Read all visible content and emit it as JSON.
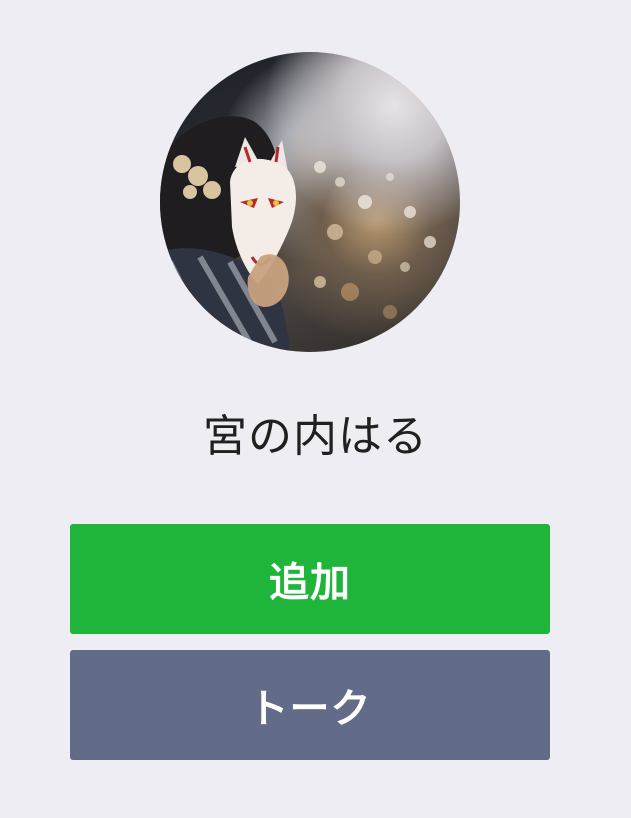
{
  "profile": {
    "name": "宮の内はる",
    "avatar_icon": "profile-photo-fox-mask"
  },
  "actions": {
    "add_label": "追加",
    "talk_label": "トーク"
  },
  "colors": {
    "background": "#efedf4",
    "add_button": "#1eb53a",
    "talk_button": "#626b87",
    "button_text": "#ffffff",
    "name_text": "#202020"
  }
}
